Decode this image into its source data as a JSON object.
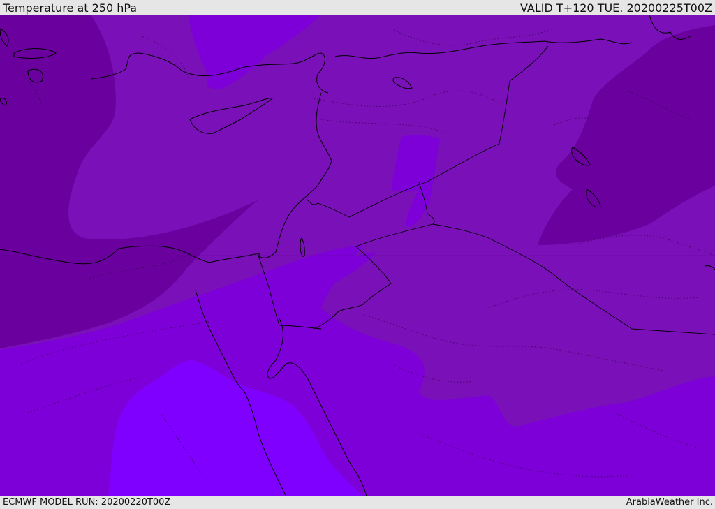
{
  "header": {
    "title": "Temperature at 250 hPa",
    "valid_time": "VALID T+120 TUE. 20200225T00Z"
  },
  "footer": {
    "model_run": "ECMWF MODEL RUN: 20200220T00Z",
    "credit": "ArabiaWeather Inc."
  },
  "colors": {
    "band_coldest": "#6a009e",
    "band_cold": "#7a10b8",
    "band_mid": "#7e00d8",
    "band_warm": "#8000ff",
    "coastline": "#000000",
    "border": "#000000"
  }
}
